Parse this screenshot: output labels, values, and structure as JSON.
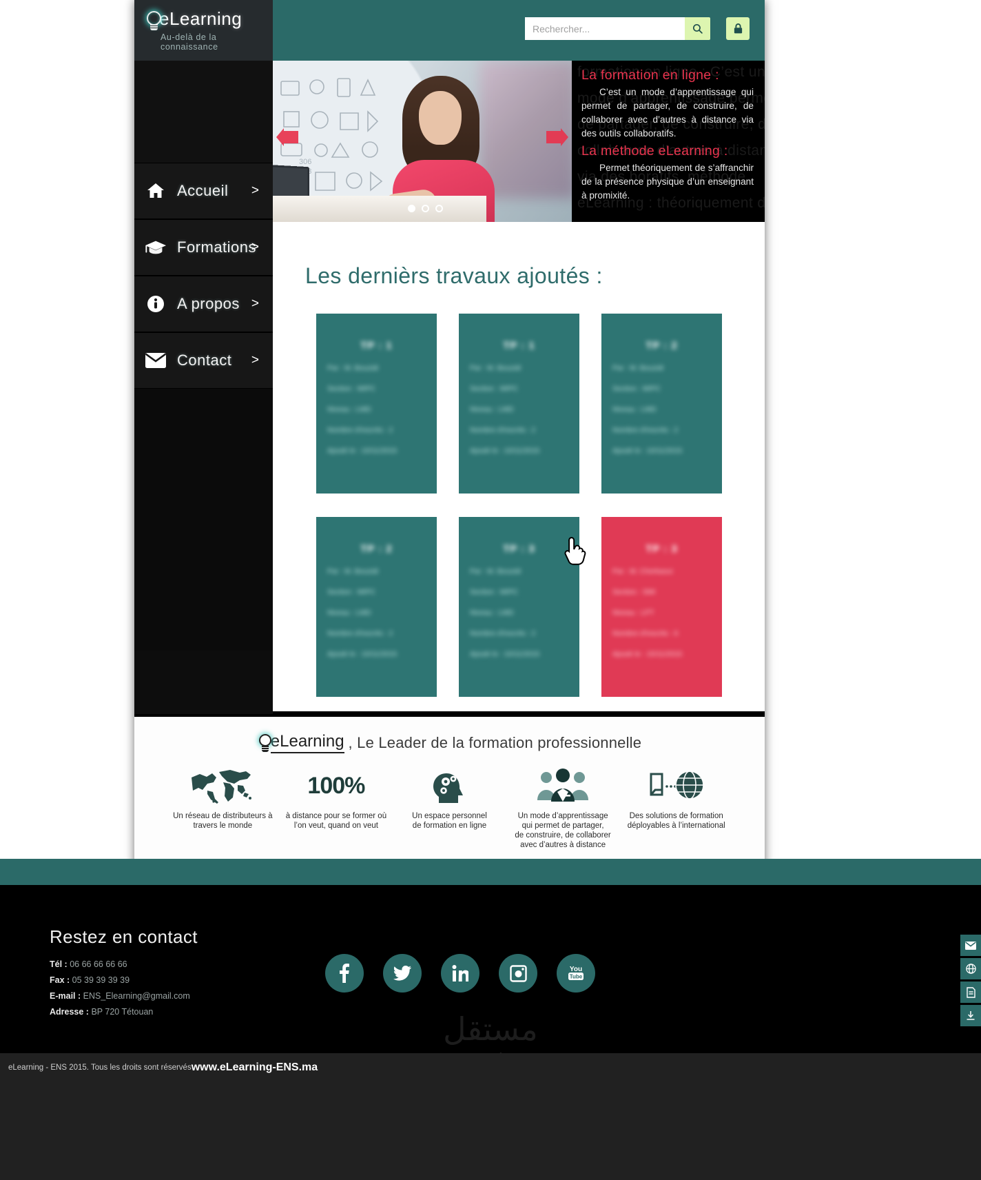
{
  "brand": {
    "name": "eLearning",
    "tagline": "Au-delà de la connaissance"
  },
  "header": {
    "search_placeholder": "Rechercher...",
    "search_value": "",
    "search_icon": "search-icon",
    "login_icon": "lock-icon"
  },
  "sidebar": {
    "items": [
      {
        "label": "Accueil",
        "icon": "home-icon",
        "arrow": ">"
      },
      {
        "label": "Formations",
        "icon": "graduation-cap-icon",
        "arrow": ">"
      },
      {
        "label": "A propos",
        "icon": "info-circle-icon",
        "arrow": ">"
      },
      {
        "label": "Contact",
        "icon": "envelope-icon",
        "arrow": ">"
      }
    ]
  },
  "banner": {
    "slide_dots": 3,
    "active_dot": 1,
    "blocks": [
      {
        "heading": "La formation en ligne :",
        "body": "C’est un mode d’apprentissage qui permet de partager, de construire, de collaborer avec d’autres à distance via des outils collaboratifs."
      },
      {
        "heading": "La méthode eLearning :",
        "body": "Permet théoriquement de s’affranchir de la présence physique d’un enseignant à promixité."
      }
    ],
    "ghost_text": "formation en ligne : C’est un mode d’apprentissage permet de partager, de construire, de collab avec d’autres à distance via des boratifs. méthode eLearning : théoriquement de s’affr"
  },
  "main": {
    "title": "Les dernièrs travaux ajoutés :",
    "cards": [
      {
        "title": "TP : 1",
        "rows": [
          "Par : M. Bouzidi",
          "Section : MIPC",
          "Niveau : LMD",
          "Nombre d'inscrits : 2",
          "Ajouté le : 10/11/2015"
        ],
        "accent": false
      },
      {
        "title": "TP : 1",
        "rows": [
          "Par : M. Bouzidi",
          "Section : MIPC",
          "Niveau : LMD",
          "Nombre d'inscrits : 2",
          "Ajouté le : 10/11/2015"
        ],
        "accent": false
      },
      {
        "title": "TP : 2",
        "rows": [
          "Par : M. Bouzidi",
          "Section : MIPC",
          "Niveau : LMD",
          "Nombre d'inscrits : 2",
          "Ajouté le : 10/11/2015"
        ],
        "accent": false
      },
      {
        "title": "TP : 2",
        "rows": [
          "Par : M. Bouzidi",
          "Section : MIPC",
          "Niveau : LMD",
          "Nombre d'inscrits : 2",
          "Ajouté le : 10/11/2015"
        ],
        "accent": false
      },
      {
        "title": "TP : 3",
        "rows": [
          "Par : M. Bouzidi",
          "Section : MIPC",
          "Niveau : LMD",
          "Nombre d'inscrits : 2",
          "Ajouté le : 10/11/2015"
        ],
        "accent": false
      },
      {
        "title": "TP : 3",
        "rows": [
          "Par : M. Cherkaoui",
          "Section : SMI",
          "Niveau : LPT",
          "Nombre d'inscrits : 6",
          "Ajouté le : 15/11/2015"
        ],
        "accent": true
      }
    ]
  },
  "features": {
    "brand": "eLearning",
    "tagline": ", Le Leader de la formation professionnelle",
    "items": [
      {
        "icon": "world-map-icon",
        "big": "",
        "caption": "Un réseau de distributeurs à\ntravers le monde"
      },
      {
        "icon": "percent-icon",
        "big": "100%",
        "caption": "à distance pour se former où\nl’on veut, quand on veut"
      },
      {
        "icon": "brain-gears-icon",
        "big": "",
        "caption": "Un espace personnel\nde formation en ligne"
      },
      {
        "icon": "people-group-icon",
        "big": "",
        "caption": "Un mode d’apprentissage\nqui permet de partager,\nde construire, de collaborer\navec d’autres à distance"
      },
      {
        "icon": "globe-doc-icon",
        "big": "",
        "caption": "Des solutions de formation\ndéployables à l’international"
      }
    ]
  },
  "footer": {
    "title": "Restez en contact",
    "contacts": [
      {
        "label": "Tél :",
        "value": "06 66 66 66 66"
      },
      {
        "label": "Fax :",
        "value": "05 39 39 39 39"
      },
      {
        "label": "E-mail :",
        "value": "ENS_Elearning@gmail.com"
      },
      {
        "label": "Adresse :",
        "value": "BP 720 Tétouan"
      }
    ],
    "socials": [
      {
        "name": "facebook-icon",
        "glyph": "f"
      },
      {
        "name": "twitter-icon",
        "glyph": "t"
      },
      {
        "name": "linkedin-icon",
        "glyph": "in"
      },
      {
        "name": "instagram-icon",
        "glyph": "ig"
      },
      {
        "name": "youtube-icon",
        "glyph": "yt"
      }
    ],
    "watermark_ar": "مستقل",
    "watermark_lat": "mostaql.com",
    "copyright_text": "eLearning - ENS 2015. Tous les droits sont réservés ",
    "copyright_site": "www.eLearning-ENS.ma"
  },
  "rail": {
    "buttons": [
      {
        "name": "mail-rail-icon"
      },
      {
        "name": "globe-rail-icon"
      },
      {
        "name": "document-rail-icon"
      },
      {
        "name": "download-rail-icon"
      }
    ]
  },
  "colors": {
    "teal": "#2b6a68",
    "card_teal": "#2e7573",
    "accent_red": "#e03a55",
    "lime": "#ddf5b0",
    "dark": "#0d0d0d",
    "banner_heading": "#e8344e"
  }
}
